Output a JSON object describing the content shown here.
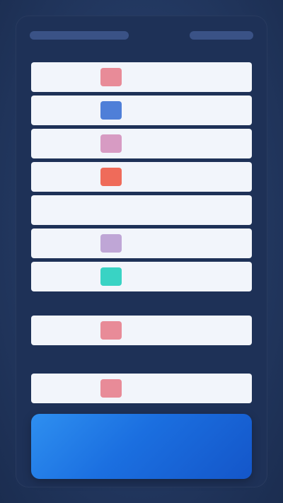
{
  "header": {
    "title": "",
    "subtitle": ""
  },
  "table": {
    "rows": [
      {
        "name": "",
        "color": "#e88b98",
        "detail": "",
        "value": ""
      },
      {
        "name": "",
        "color": "#4f7fd8",
        "detail": "",
        "value": ""
      },
      {
        "name": "",
        "color": "#d79bc3",
        "detail": "",
        "value": ""
      },
      {
        "name": "",
        "color": "#ef6b5a",
        "detail": "",
        "value": ""
      },
      {
        "name": "",
        "color": "#f2f5fb",
        "detail": "",
        "value": ""
      },
      {
        "name": "",
        "color": "#bfa6d6",
        "detail": "",
        "value": ""
      },
      {
        "name": "",
        "color": "#39d3c4",
        "detail": "",
        "value": ""
      }
    ]
  },
  "section_a": {
    "label": "",
    "row": {
      "name": "",
      "color": "#e88b98",
      "detail": "",
      "value": ""
    }
  },
  "section_b": {
    "label": "",
    "row": {
      "name": "",
      "color": "#e88b98",
      "detail": "",
      "value": ""
    }
  },
  "cta": {
    "title": "",
    "subtitle": ""
  }
}
